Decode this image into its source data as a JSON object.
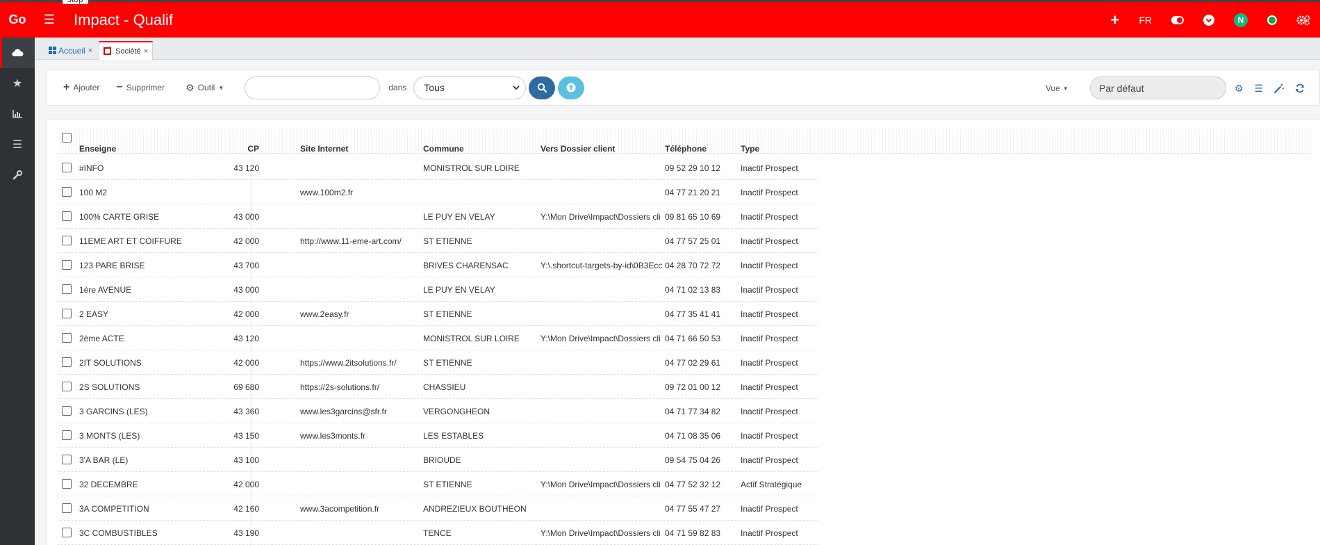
{
  "tooltip": "stop",
  "header": {
    "brand": "Go",
    "title": "Impact - Qualif",
    "language": "FR",
    "avatar_letter": "N",
    "accent": "#ff0000"
  },
  "tabs": [
    {
      "label": "Accueil"
    },
    {
      "label": "Société"
    }
  ],
  "toolbar": {
    "add_label": "Ajouter",
    "delete_label": "Supprimer",
    "tool_label": "Outil",
    "search_placeholder": "",
    "dans_label": "dans",
    "scope_selected": "Tous",
    "view_label": "Vue",
    "view_placeholder": "Par défaut"
  },
  "table": {
    "columns": [
      "Enseigne",
      "CP",
      "Site Internet",
      "Commune",
      "Vers Dossier client",
      "Téléphone",
      "Type"
    ],
    "rows": [
      {
        "enseigne": "#INFO",
        "cp": "43 120",
        "site": "",
        "commune": "MONISTROL SUR LOIRE",
        "dossier": "",
        "tel": "09 52 29 10 12",
        "type": "Inactif Prospect"
      },
      {
        "enseigne": "100 M2",
        "cp": "",
        "site": "www.100m2.fr",
        "commune": "",
        "dossier": "",
        "tel": "04 77 21 20 21",
        "type": "Inactif Prospect"
      },
      {
        "enseigne": "100% CARTE GRISE",
        "cp": "43 000",
        "site": "",
        "commune": "LE PUY EN VELAY",
        "dossier": "Y:\\Mon Drive\\Impact\\Dossiers cli",
        "tel": "09 81 65 10 69",
        "type": "Inactif Prospect"
      },
      {
        "enseigne": "11EME ART ET COIFFURE",
        "cp": "42 000",
        "site": "http://www.11-eme-art.com/",
        "commune": "ST ETIENNE",
        "dossier": "",
        "tel": "04 77 57 25 01",
        "type": "Inactif Prospect"
      },
      {
        "enseigne": "123 PARE BRISE",
        "cp": "43 700",
        "site": "",
        "commune": "BRIVES CHARENSAC",
        "dossier": "Y:\\.shortcut-targets-by-id\\0B3Ecc",
        "tel": "04 28 70 72 72",
        "type": "Inactif Prospect"
      },
      {
        "enseigne": "1ère AVENUE",
        "cp": "43 000",
        "site": "",
        "commune": "LE PUY EN VELAY",
        "dossier": "",
        "tel": "04 71 02 13 83",
        "type": "Inactif Prospect"
      },
      {
        "enseigne": "2 EASY",
        "cp": "42 000",
        "site": "www.2easy.fr",
        "commune": "ST ETIENNE",
        "dossier": "",
        "tel": "04 77 35 41 41",
        "type": "Inactif Prospect"
      },
      {
        "enseigne": "2ème ACTE",
        "cp": "43 120",
        "site": "",
        "commune": "MONISTROL SUR LOIRE",
        "dossier": "Y:\\Mon Drive\\Impact\\Dossiers cli",
        "tel": "04 71 66 50 53",
        "type": "Inactif Prospect"
      },
      {
        "enseigne": "2IT SOLUTIONS",
        "cp": "42 000",
        "site": "https://www.2itsolutions.fr/",
        "commune": "ST ETIENNE",
        "dossier": "",
        "tel": "04 77 02 29 61",
        "type": "Inactif Prospect"
      },
      {
        "enseigne": "2S SOLUTIONS",
        "cp": "69 680",
        "site": "https://2s-solutions.fr/",
        "commune": "CHASSIEU",
        "dossier": "",
        "tel": "09 72 01 00 12",
        "type": "Inactif Prospect"
      },
      {
        "enseigne": "3 GARCINS (LES)",
        "cp": "43 360",
        "site": "www.les3garcins@sfr.fr",
        "commune": "VERGONGHEON",
        "dossier": "",
        "tel": "04 71 77 34 82",
        "type": "Inactif Prospect"
      },
      {
        "enseigne": "3 MONTS (LES)",
        "cp": "43 150",
        "site": "www.les3monts.fr",
        "commune": "LES ESTABLES",
        "dossier": "",
        "tel": "04 71 08 35 06",
        "type": "Inactif Prospect"
      },
      {
        "enseigne": "3'A BAR (LE)",
        "cp": "43 100",
        "site": "",
        "commune": "BRIOUDE",
        "dossier": "",
        "tel": "09 54 75 04 26",
        "type": "Inactif Prospect"
      },
      {
        "enseigne": "32 DECEMBRE",
        "cp": "42 000",
        "site": "",
        "commune": "ST ETIENNE",
        "dossier": "Y:\\Mon Drive\\Impact\\Dossiers cli",
        "tel": "04 77 52 32 12",
        "type": "Actif Stratégique"
      },
      {
        "enseigne": "3A COMPETITION",
        "cp": "42 160",
        "site": "www.3acompetition.fr",
        "commune": "ANDREZIEUX BOUTHEON",
        "dossier": "",
        "tel": "04 77 55 47 27",
        "type": "Inactif Prospect"
      },
      {
        "enseigne": "3C COMBUSTIBLES",
        "cp": "43 190",
        "site": "",
        "commune": "TENCE",
        "dossier": "Y:\\Mon Drive\\Impact\\Dossiers cli",
        "tel": "04 71 59 82 83",
        "type": "Inactif Prospect"
      }
    ]
  }
}
